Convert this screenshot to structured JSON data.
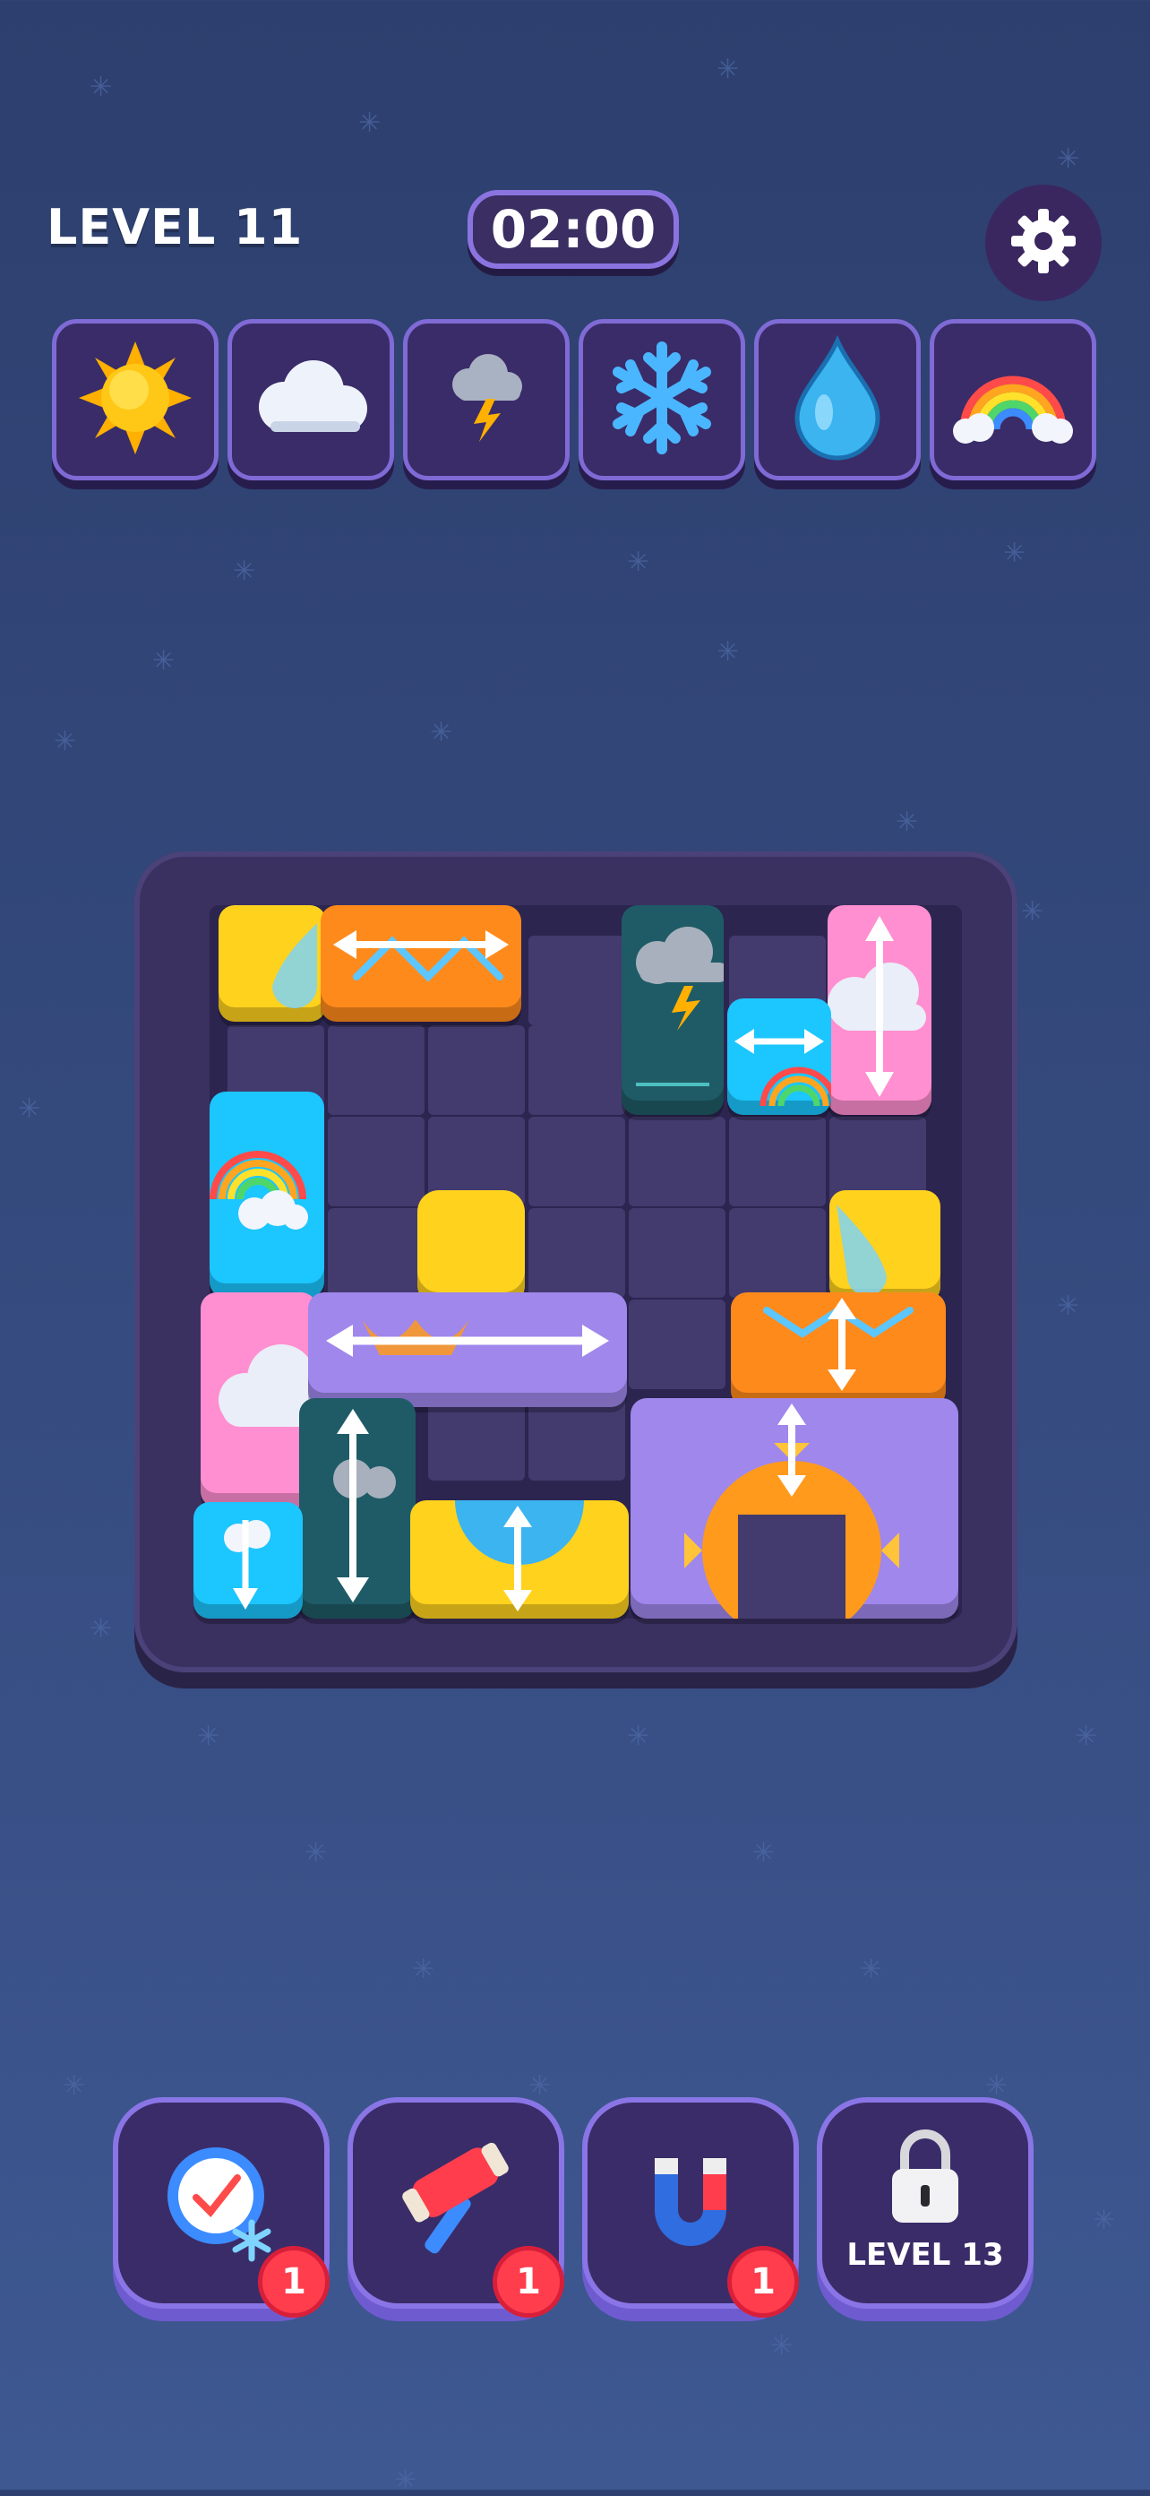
{
  "header": {
    "level_label": "LEVEL 11",
    "timer": "02:00",
    "settings_icon": "gear-icon"
  },
  "targets": [
    {
      "icon": "sun-icon"
    },
    {
      "icon": "cloud-icon"
    },
    {
      "icon": "storm-cloud-icon"
    },
    {
      "icon": "snowflake-icon"
    },
    {
      "icon": "water-drop-icon"
    },
    {
      "icon": "rainbow-icon"
    }
  ],
  "powerups": [
    {
      "icon": "time-freeze-icon",
      "count": "1"
    },
    {
      "icon": "hammer-icon",
      "count": "1"
    },
    {
      "icon": "magnet-icon",
      "count": "1"
    },
    {
      "icon": "lock-icon",
      "locked_label": "LEVEL 13"
    }
  ],
  "colors": {
    "yellow": "#ffd21e",
    "orange": "#ff8a1c",
    "teal": "#1f5b66",
    "pink": "#ff8fd0",
    "cyan": "#1cc6ff",
    "lavender": "#9f87ec"
  }
}
